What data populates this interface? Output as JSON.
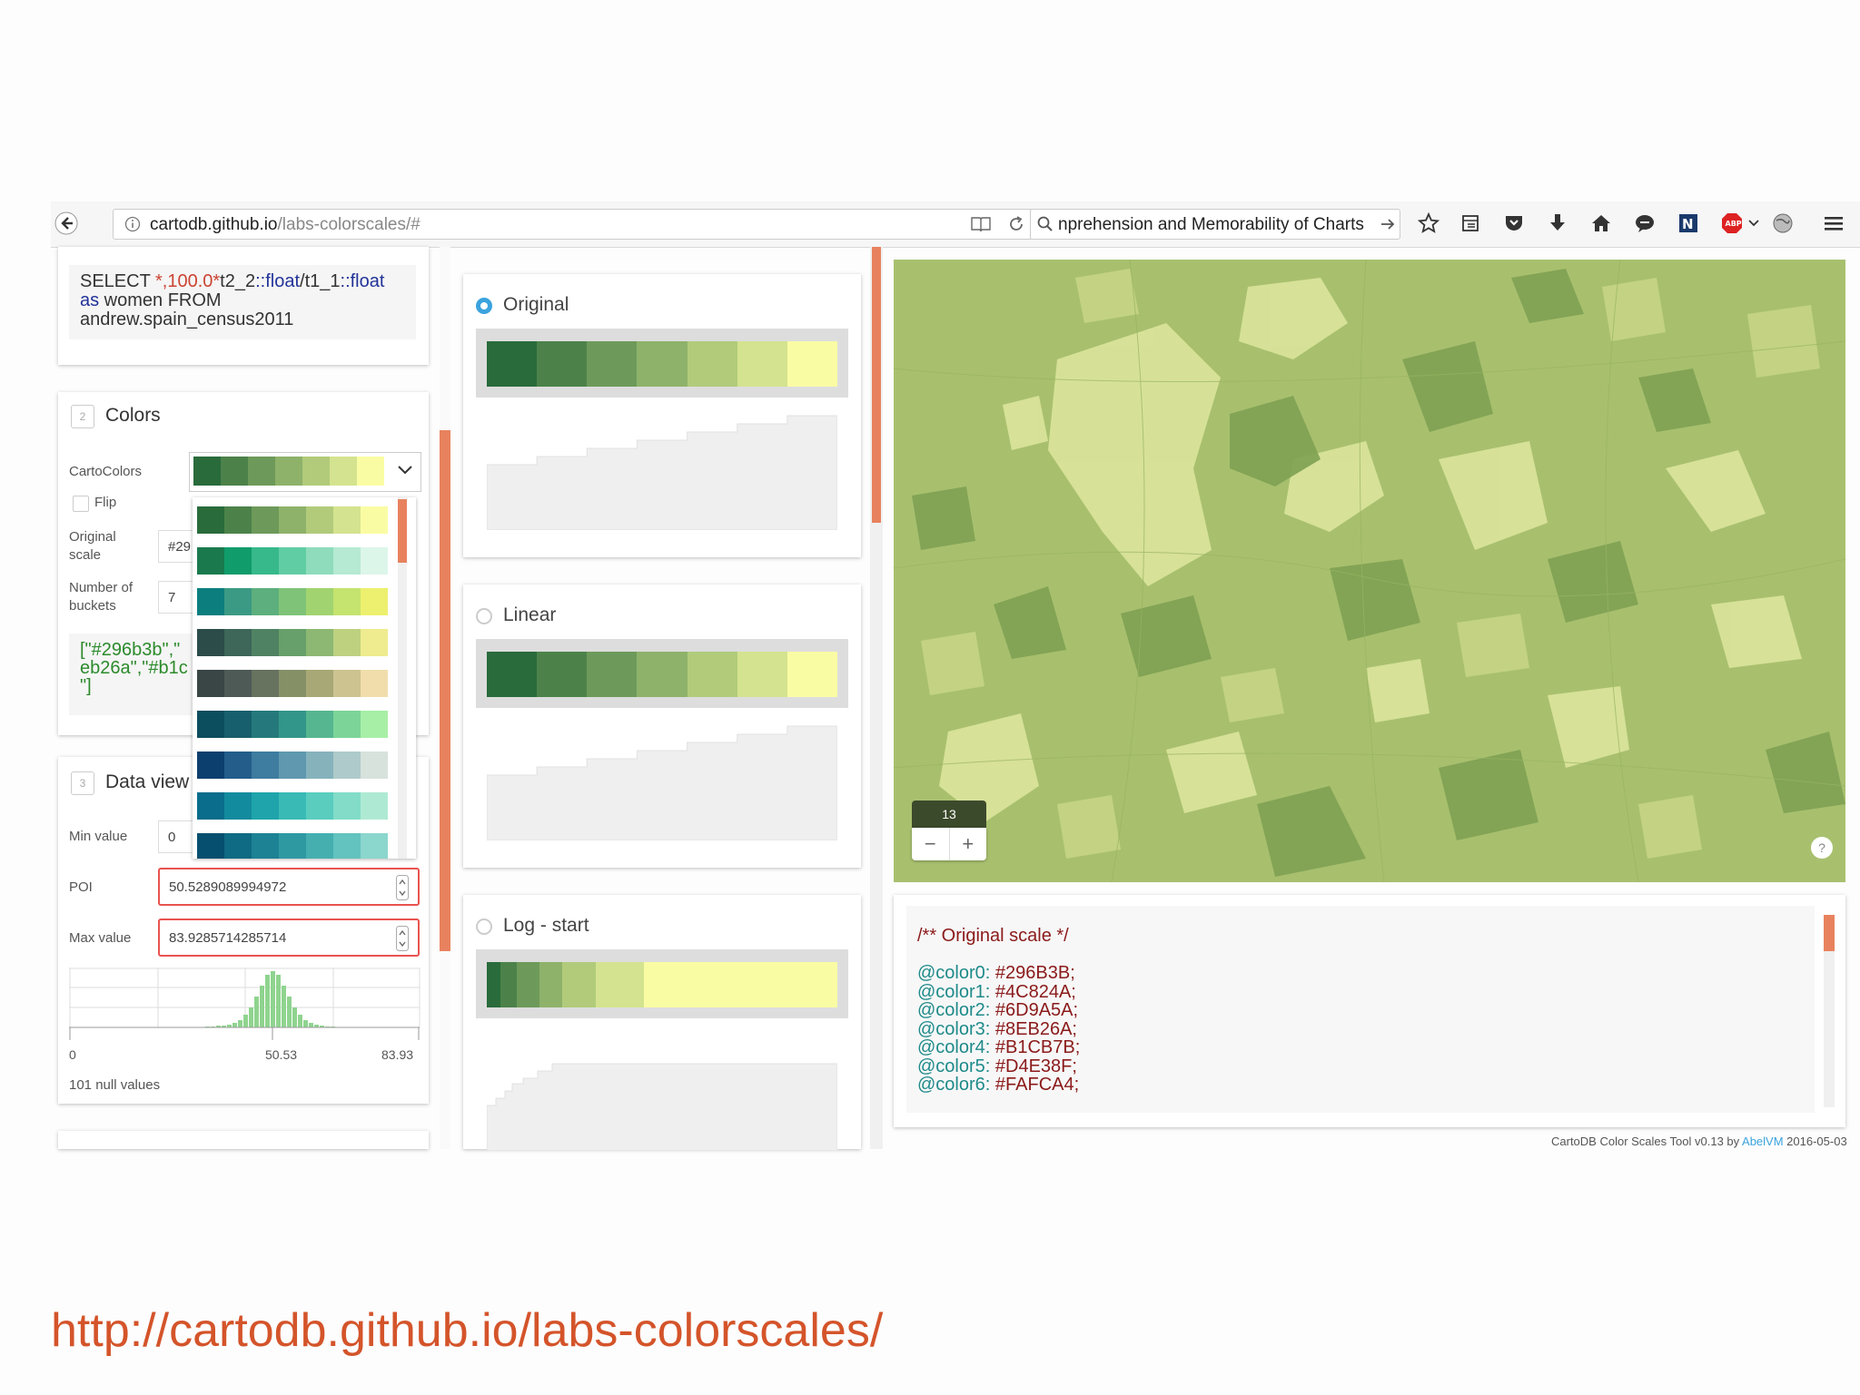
{
  "browser": {
    "url_domain": "cartodb.github.io",
    "url_path": "/labs-colorscales/#",
    "search_text": "nprehension  and Memorability of Charts"
  },
  "query": {
    "part1": "SELECT ",
    "part2": "*,100.0*",
    "part3": "t2_2",
    "part4": "::float",
    "part5": "/t1_1",
    "part6": "::float",
    "part7": "as",
    "part8": " women FROM",
    "part9": "andrew.spain_census2011"
  },
  "colors_section": {
    "number": "2",
    "title": "Colors",
    "cartocolors_label": "CartoColors",
    "flip_label": "Flip",
    "original_scale_label_1": "Original",
    "original_scale_label_2": "scale",
    "original_scale_value": "#29",
    "buckets_label_1": "Number of",
    "buckets_label_2": "buckets",
    "buckets_value": "7",
    "json_line1": "[\"#296b3b\",\"",
    "json_line2": "eb26a\",\"#b1c",
    "json_line3": "\"]",
    "selected_ramp": [
      "#296B3B",
      "#4C824A",
      "#6D9A5A",
      "#8EB26A",
      "#B1CB7B",
      "#D4E38F",
      "#FAFCA4"
    ],
    "ramp_options": [
      [
        "#296B3B",
        "#4C824A",
        "#6D9A5A",
        "#8EB26A",
        "#B1CB7B",
        "#D4E38F",
        "#FAFCA4"
      ],
      [
        "#1A7A4E",
        "#109C6B",
        "#37B98C",
        "#61CDA4",
        "#8FDCBC",
        "#B6EAD2",
        "#DDF6EA"
      ],
      [
        "#0D7E7E",
        "#3B9A84",
        "#5DAF7D",
        "#7FC378",
        "#A1D470",
        "#C5E36F",
        "#EDF06E"
      ],
      [
        "#2C4C4A",
        "#3E6659",
        "#4F8262",
        "#67A06A",
        "#8CB873",
        "#BDD17F",
        "#EEEC8E"
      ],
      [
        "#3A4646",
        "#4E5A56",
        "#67725F",
        "#869067",
        "#A8A876",
        "#CCC390",
        "#F1DDAB"
      ],
      [
        "#0C4D5E",
        "#175F6C",
        "#25797C",
        "#33968A",
        "#56B690",
        "#7CD498",
        "#A7EFA7"
      ],
      [
        "#0C3F6E",
        "#245D8A",
        "#3E7CA0",
        "#5F98AF",
        "#86B2BC",
        "#AECACA",
        "#D7E2DC"
      ],
      [
        "#0A6D8C",
        "#138B9E",
        "#1FA4AB",
        "#39BAB5",
        "#5ACDBF",
        "#82DCC8",
        "#AEEAD3"
      ],
      [
        "#064F6E",
        "#0F6A83",
        "#1D8294",
        "#2F99A2",
        "#45AFB0",
        "#63C3BE",
        "#8BD6CD"
      ]
    ]
  },
  "data_view": {
    "number": "3",
    "title": "Data view",
    "min_label": "Min value",
    "min_value": "0",
    "poi_label": "POI",
    "poi_value": "50.5289089994972",
    "max_label": "Max value",
    "max_value": "83.9285714285714",
    "hist_tick_min": "0",
    "hist_tick_mid": "50.53",
    "hist_tick_max": "83.93",
    "null_values": "101 null values"
  },
  "scales": [
    {
      "name": "Original",
      "selected": true,
      "ramp": [
        1,
        1,
        1,
        1,
        1,
        1,
        1
      ],
      "steps": [
        1,
        2,
        3,
        4,
        5,
        6,
        7
      ]
    },
    {
      "name": "Linear",
      "selected": false,
      "ramp": [
        1,
        1,
        1,
        1,
        1,
        1,
        1
      ],
      "steps": [
        1,
        2,
        3,
        4,
        5,
        6,
        7
      ]
    },
    {
      "name": "Log - start",
      "selected": false,
      "ramp": [
        0.12,
        0.14,
        0.2,
        0.2,
        0.3,
        0.42,
        1.7
      ],
      "steps": [
        1,
        2,
        3,
        4,
        5,
        6,
        7
      ]
    }
  ],
  "ramp_colors": [
    "#296B3B",
    "#4C824A",
    "#6D9A5A",
    "#8EB26A",
    "#B1CB7B",
    "#D4E38F",
    "#FAFCA4"
  ],
  "map": {
    "zoom_level": "13",
    "zoom_out": "−",
    "zoom_in": "+",
    "help": "?"
  },
  "code_panel": {
    "comment": "/** Original scale */",
    "lines": [
      {
        "var": "@color0:",
        "val": " #296B3B;"
      },
      {
        "var": "@color1:",
        "val": " #4C824A;"
      },
      {
        "var": "@color2:",
        "val": " #6D9A5A;"
      },
      {
        "var": "@color3:",
        "val": " #8EB26A;"
      },
      {
        "var": "@color4:",
        "val": " #B1CB7B;"
      },
      {
        "var": "@color5:",
        "val": " #D4E38F;"
      },
      {
        "var": "@color6:",
        "val": " #FAFCA4;"
      }
    ]
  },
  "footer": {
    "credit_prefix": "CartoDB Color Scales Tool v0.13 by ",
    "credit_author": "AbelVM",
    "credit_date": " 2016-05-03"
  },
  "slide_link": "http://cartodb.github.io/labs-colorscales/",
  "accent_color": "#e8663d"
}
